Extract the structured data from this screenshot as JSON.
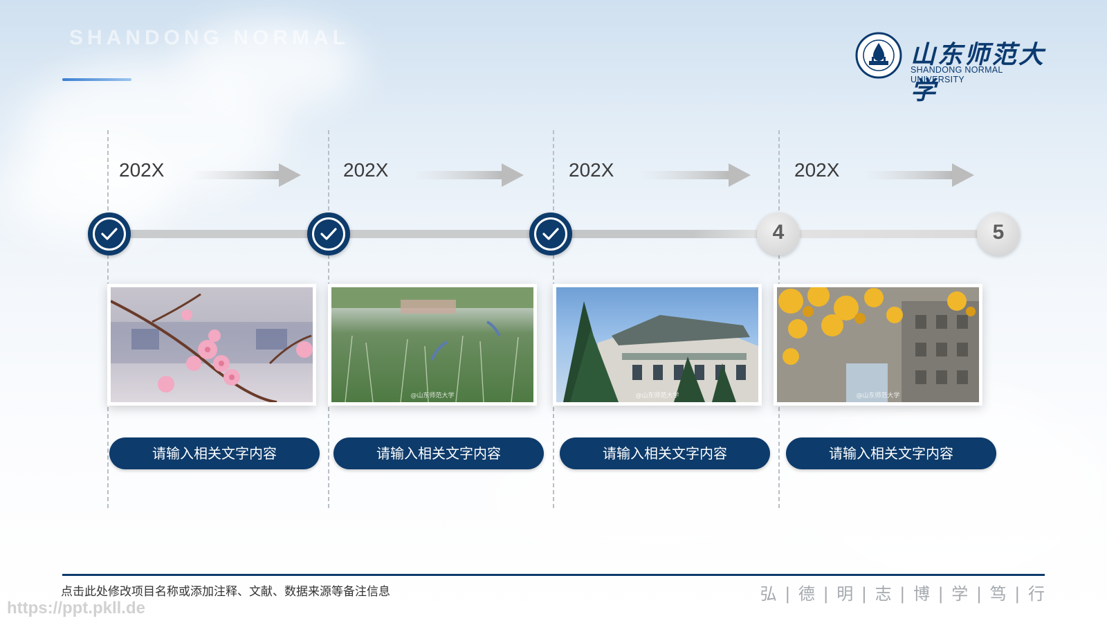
{
  "header": {
    "faint_title": "SHANDONG NORMAL",
    "logo_cn": "山东师范大学",
    "logo_en": "SHANDONG NORMAL UNIVERSITY"
  },
  "timeline": {
    "milestones": [
      {
        "year": "202X",
        "status": "done",
        "label": "请输入相关文字内容",
        "photo": "peach-blossom"
      },
      {
        "year": "202X",
        "status": "done",
        "label": "请输入相关文字内容",
        "photo": "grass-field-birds"
      },
      {
        "year": "202X",
        "status": "done",
        "label": "请输入相关文字内容",
        "photo": "campus-building"
      },
      {
        "year": "202X",
        "status": "pending",
        "label": "请输入相关文字内容",
        "photo": "ginkgo-building"
      }
    ],
    "nodes": [
      "check",
      "check",
      "check",
      "4",
      "5"
    ],
    "photo_watermark": "@山东师范大学"
  },
  "footer": {
    "note": "点击此处修改项目名称或添加注释、文献、数据来源等备注信息",
    "motto": "弘 | 德 | 明 | 志 | 博 | 学 | 笃 | 行",
    "url": "https://ppt.pkll.de"
  },
  "colors": {
    "primary_navy": "#0d3b6b",
    "track_gray": "#c9cbcd",
    "accent_blue": "#3a7fd0"
  }
}
